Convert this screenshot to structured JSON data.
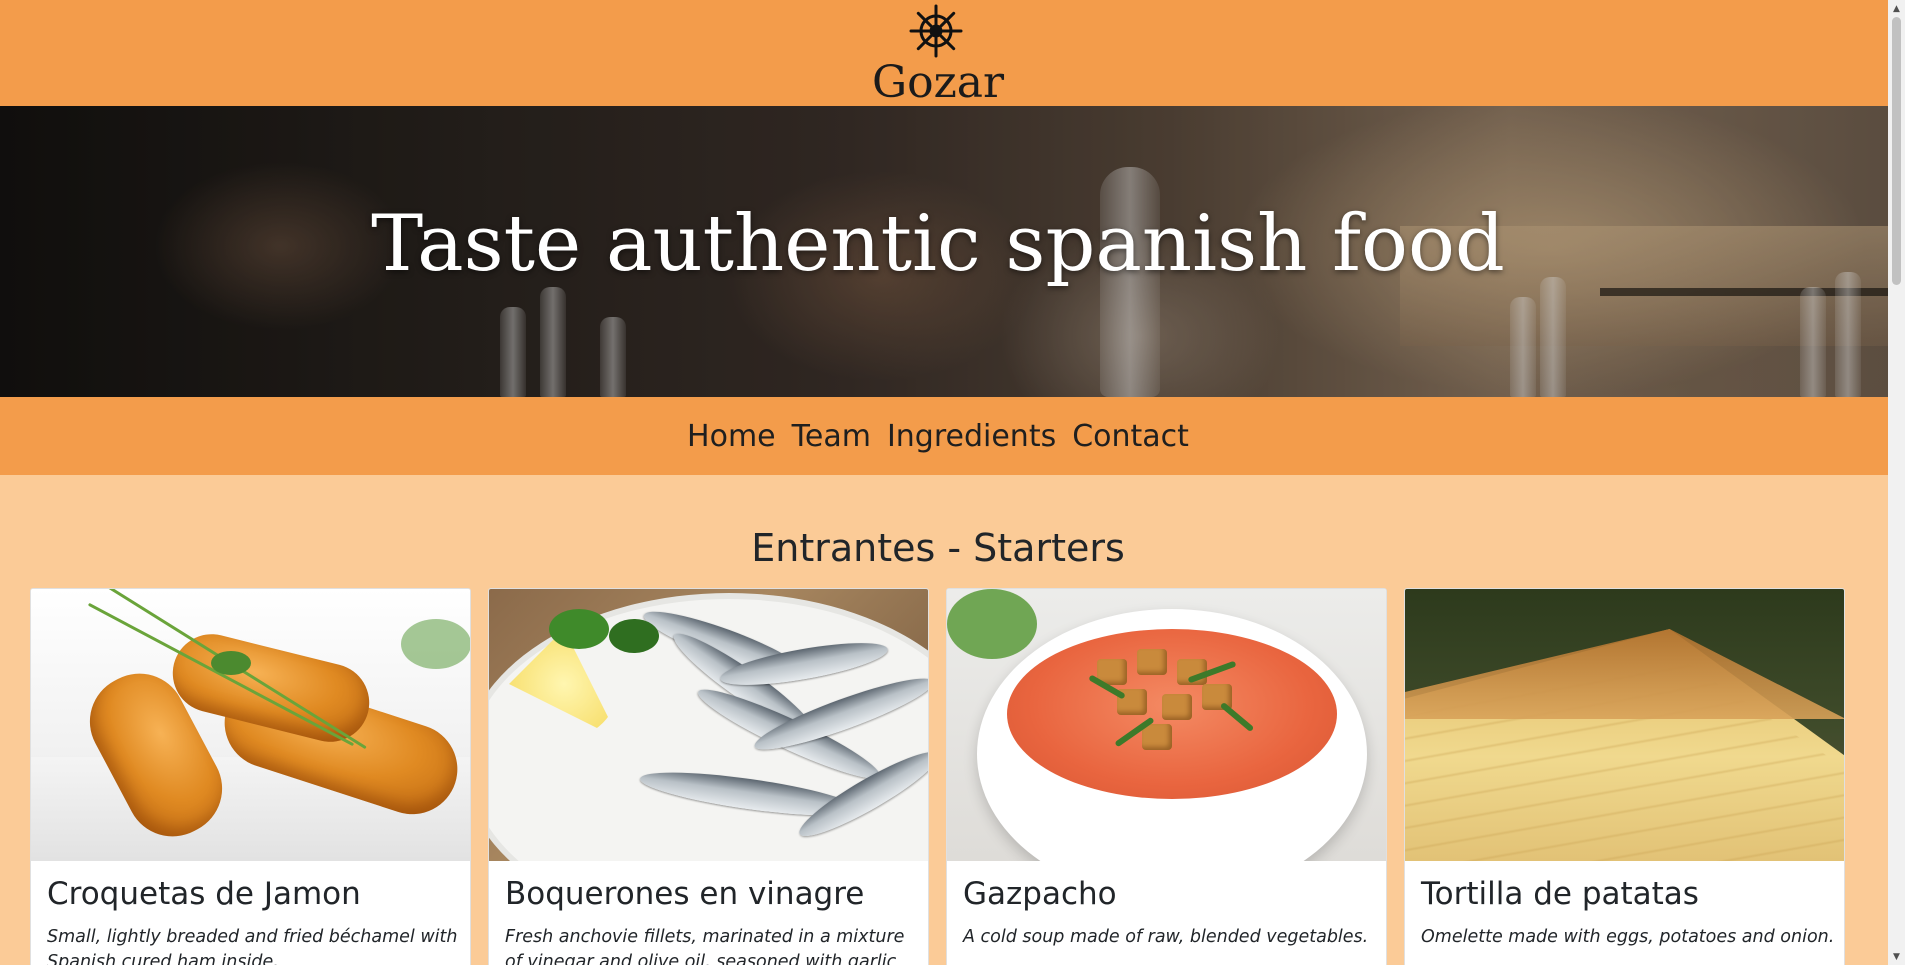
{
  "header": {
    "logo_icon": "ship-wheel-icon",
    "brand": "Gozar",
    "background_color": "#f39c4b"
  },
  "hero": {
    "title": "Taste authentic spanish food"
  },
  "nav": {
    "items": [
      {
        "label": "Home"
      },
      {
        "label": "Team"
      },
      {
        "label": "Ingredients"
      },
      {
        "label": "Contact"
      }
    ]
  },
  "section": {
    "title": "Entrantes - Starters",
    "background_color": "#fbcb97"
  },
  "cards": [
    {
      "title": "Croquetas de Jamon",
      "description": "Small, lightly breaded and fried béchamel with Spanish cured ham inside."
    },
    {
      "title": "Boquerones en vinagre",
      "description": "Fresh anchovie fillets, marinated in a mixture of vinegar and olive oil, seasoned with garlic and parsley."
    },
    {
      "title": "Gazpacho",
      "description": "A cold soup made of raw, blended vegetables."
    },
    {
      "title": "Tortilla de patatas",
      "description": "Omelette made with eggs, potatoes and onion."
    }
  ],
  "scrollbar": {
    "up_icon": "scroll-up-arrow-icon",
    "down_icon": "scroll-down-arrow-icon"
  }
}
